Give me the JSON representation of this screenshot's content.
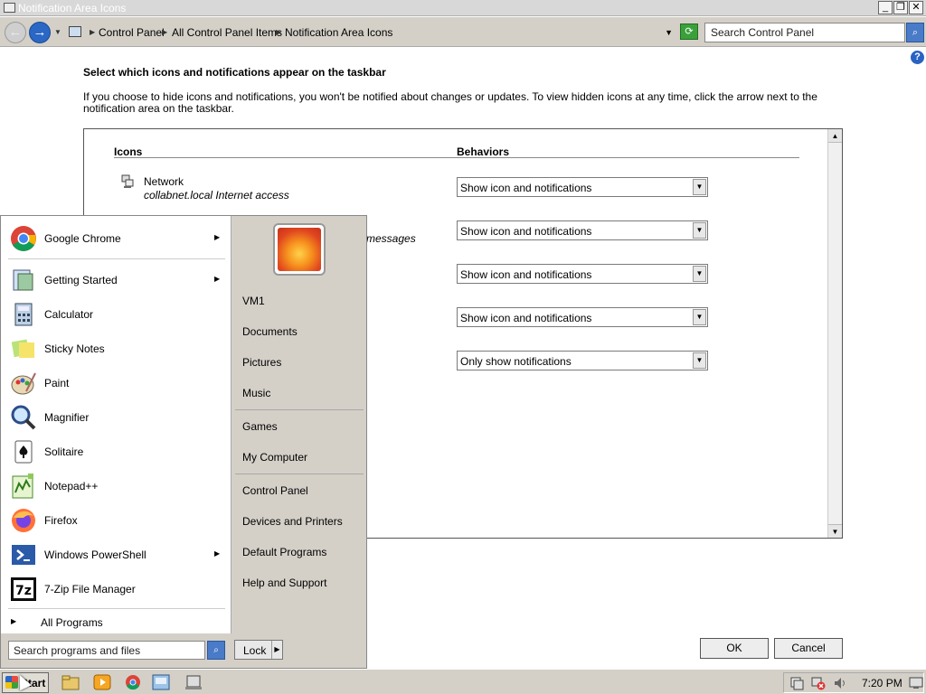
{
  "window": {
    "title": "Notification Area Icons"
  },
  "address_bar": {
    "crumbs": [
      "Control Panel",
      "All Control Panel Items",
      "Notification Area Icons"
    ],
    "search_placeholder": "Search Control Panel"
  },
  "content": {
    "heading": "Select which icons and notifications appear on the taskbar",
    "description": "If you choose to hide icons and notifications, you won't be notified about changes or updates. To view hidden icons at any time, click the arrow next to the notification area on the taskbar.",
    "col_icons": "Icons",
    "col_behaviors": "Behaviors",
    "rows": [
      {
        "name": "Network",
        "desc": "collabnet.local Internet access",
        "behavior": "Show icon and notifications"
      },
      {
        "name": "",
        "desc": "messages",
        "behavior": "Show icon and notifications"
      },
      {
        "name": "",
        "desc": "",
        "behavior": "Show icon and notifications"
      },
      {
        "name": "",
        "desc": "",
        "behavior": "Show icon and notifications"
      },
      {
        "name": "",
        "desc": "",
        "behavior": "Only show notifications"
      }
    ]
  },
  "buttons": {
    "ok": "OK",
    "cancel": "Cancel"
  },
  "start_menu": {
    "programs": [
      {
        "label": "Google Chrome",
        "icon": "chrome-icon",
        "submenu": true
      },
      {
        "label": "Getting Started",
        "icon": "getting-started-icon",
        "submenu": true
      },
      {
        "label": "Calculator",
        "icon": "calculator-icon",
        "submenu": false
      },
      {
        "label": "Sticky Notes",
        "icon": "sticky-notes-icon",
        "submenu": false
      },
      {
        "label": "Paint",
        "icon": "paint-icon",
        "submenu": false
      },
      {
        "label": "Magnifier",
        "icon": "magnifier-icon",
        "submenu": false
      },
      {
        "label": "Solitaire",
        "icon": "solitaire-icon",
        "submenu": false
      },
      {
        "label": "Notepad++",
        "icon": "notepad-plus-plus-icon",
        "submenu": false
      },
      {
        "label": "Firefox",
        "icon": "firefox-icon",
        "submenu": false
      },
      {
        "label": "Windows PowerShell",
        "icon": "powershell-icon",
        "submenu": true
      },
      {
        "label": "7-Zip File Manager",
        "icon": "7zip-icon",
        "submenu": false
      }
    ],
    "all_programs": "All Programs",
    "search_placeholder": "Search programs and files",
    "places": [
      "VM1",
      "Documents",
      "Pictures",
      "Music",
      "Games",
      "My Computer",
      "Control Panel",
      "Devices and Printers",
      "Default Programs",
      "Help and Support"
    ],
    "lock_label": "Lock"
  },
  "taskbar": {
    "start_label": "Start",
    "clock": "7:20 PM"
  }
}
